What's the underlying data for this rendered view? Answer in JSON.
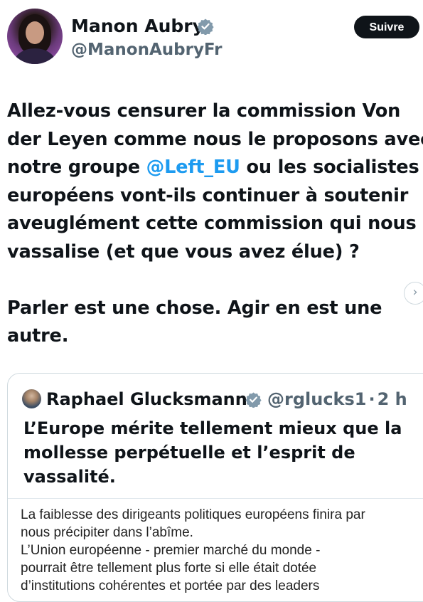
{
  "author": {
    "name": "Manon Aubry",
    "handle": "@ManonAubryFr",
    "follow_label": "Suivre",
    "verified_icon": "verified-badge-icon",
    "badge_color": "#829aab"
  },
  "tweet": {
    "line1": "Allez-vous censurer la commission Von",
    "line2": "der Leyen comme nous le proposons avec",
    "line3_before": "notre groupe ",
    "line3_mention": "@Left_EU",
    "line3_after": " ou les socialistes",
    "line4": "européens vont-ils continuer à soutenir",
    "line5": "aveuglément cette commission qui nous",
    "line6": "vassalise (et que vous avez élue) ?",
    "line7": "Parler est une chose. Agir en est une",
    "line8": "autre.",
    "mention_color": "#1d9bf0"
  },
  "nav": {
    "next_icon": "chevron-right-icon",
    "next_glyph": "›"
  },
  "quote": {
    "name": "Raphael Glucksmann",
    "handle": "@rglucks1",
    "separator": "·",
    "time": "2 h",
    "headline1": "L’Europe mérite tellement mieux que la",
    "headline2": "mollesse perpétuelle et l’esprit de",
    "headline3": "vassalité.",
    "body1": "La faiblesse des dirigeants politiques européens finira par",
    "body2": "nous précipiter dans l’abîme.",
    "body3": "L’Union européenne - premier marché du monde -",
    "body4": "pourrait être tellement plus forte si elle était dotée",
    "body5": "d’institutions cohérentes et portée par des leaders"
  }
}
